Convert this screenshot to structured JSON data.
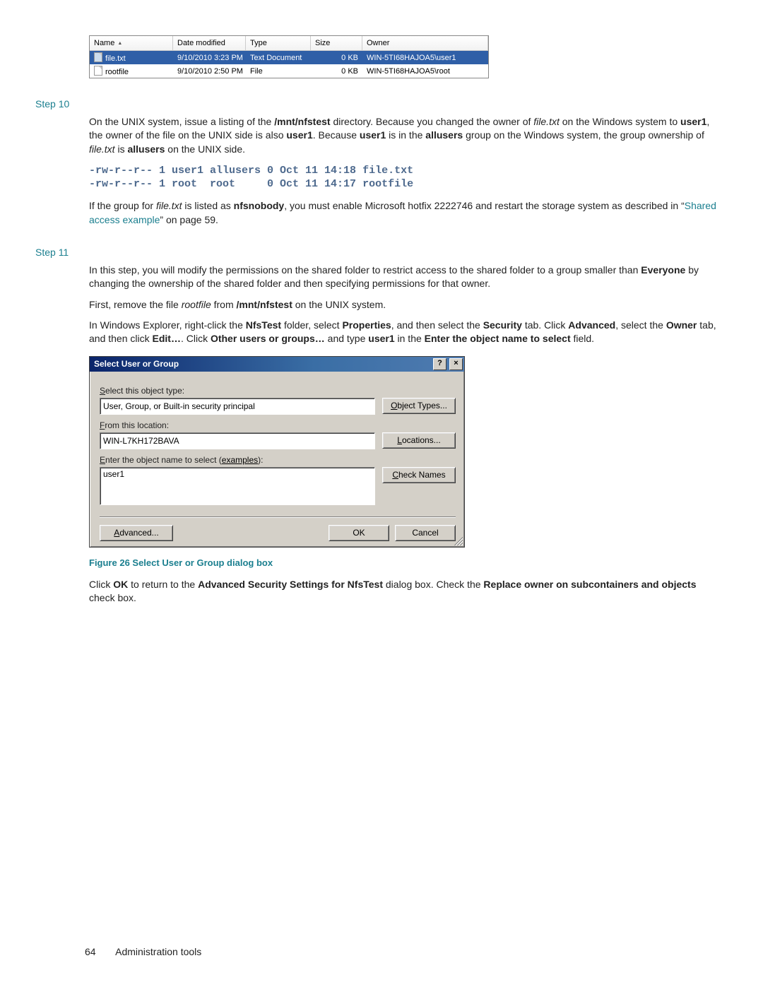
{
  "explorer": {
    "columns": [
      "Name",
      "Date modified",
      "Type",
      "Size",
      "Owner"
    ],
    "rows": [
      {
        "name": "file.txt",
        "date": "9/10/2010 3:23 PM",
        "type": "Text Document",
        "size": "0 KB",
        "owner": "WIN-5TI68HAJOA5\\user1",
        "selected": true
      },
      {
        "name": "rootfile",
        "date": "9/10/2010 2:50 PM",
        "type": "File",
        "size": "0 KB",
        "owner": "WIN-5TI68HAJOA5\\root",
        "selected": false
      }
    ]
  },
  "step10": {
    "label": "Step 10",
    "para_part1": "On the UNIX system, issue a listing of the ",
    "mnt1": "/mnt/nfstest",
    "para_part2": " directory. Because you changed the owner of ",
    "file1": "file.txt",
    "para_part3": " on the Windows system to ",
    "user1a": "user1",
    "para_part4": ", the owner of the file on the UNIX side is also ",
    "user1b": "user1",
    "para_part5": ". Because ",
    "user1c": "user1",
    "para_part6": " is in the ",
    "allusers1": "allusers",
    "para_part7": " group on the Windows system, the group ownership of ",
    "file2": "file.txt",
    "para_part8": " is ",
    "allusers2": "allusers",
    "para_part9": " on the UNIX side.",
    "listing_line1": "-rw-r--r-- 1 user1 allusers 0 Oct 11 14:18 file.txt",
    "listing_line2": "-rw-r--r-- 1 root  root     0 Oct 11 14:17 rootfile",
    "after_part1": "If the group for ",
    "file3": "file.txt",
    "after_part2": " is listed as ",
    "nfsnobody": "nfsnobody",
    "after_part3": ", you must enable Microsoft hotfix 2222746 and restart the storage system as described in “",
    "linktext": "Shared access example",
    "after_part4": "” on page 59."
  },
  "step11": {
    "label": "Step 11",
    "p1_part1": "In this step, you will modify the permissions on the shared folder to restrict access to the shared folder to a group smaller than ",
    "everyone": "Everyone",
    "p1_part2": " by changing the ownership of the shared folder and then specifying permissions for that owner.",
    "p2_part1": "First, remove the file ",
    "rootfile_i": "rootfile",
    "p2_part2": " from ",
    "mnt": "/mnt/nfstest",
    "p2_part3": " on the UNIX system.",
    "p3_part1": "In Windows Explorer, right-click the ",
    "nfstest": "NfsTest",
    "p3_part2": " folder, select ",
    "properties": "Properties",
    "p3_part3": ", and then select the ",
    "security": "Security",
    "p3_part4": " tab. Click ",
    "advanced": "Advanced",
    "p3_part5": ", select the ",
    "owner": "Owner",
    "p3_part6": " tab, and then click ",
    "edit": "Edit…",
    "p3_part7": ". Click ",
    "other": "Other users or groups…",
    "p3_part8": " and type ",
    "user1": "user1",
    "p3_part9": " in the ",
    "enterfield": "Enter the object name to select",
    "p3_part10": " field."
  },
  "dialog": {
    "title": "Select User or Group",
    "help_icon": "?",
    "close_icon": "×",
    "label_object_type_S": "S",
    "label_object_type_rest": "elect this object type:",
    "object_type_value": "User, Group, or Built-in security principal",
    "btn_object_types_O": "O",
    "btn_object_types_rest": "bject Types...",
    "label_from_F": "F",
    "label_from_rest": "rom this location:",
    "location_value": "WIN-L7KH172BAVA",
    "btn_locations_L": "L",
    "btn_locations_rest": "ocations...",
    "label_enter_E": "E",
    "label_enter_rest": "nter the object name to select (",
    "examples": "examples",
    "label_enter_close": "):",
    "entered_value": "user1",
    "btn_check_C": "C",
    "btn_check_rest": "heck Names",
    "btn_advanced_A": "A",
    "btn_advanced_rest": "dvanced...",
    "btn_ok": "OK",
    "btn_cancel": "Cancel"
  },
  "figure_caption": "Figure 26 Select User or Group dialog box",
  "after_dialog": {
    "p_part1": "Click ",
    "ok": "OK",
    "p_part2": " to return to the ",
    "advsec": "Advanced Security Settings for NfsTest",
    "p_part3": " dialog box. Check the ",
    "replace": "Replace owner on subcontainers and objects",
    "p_part4": " check box."
  },
  "footer": {
    "page_number": "64",
    "section": "Administration tools"
  }
}
